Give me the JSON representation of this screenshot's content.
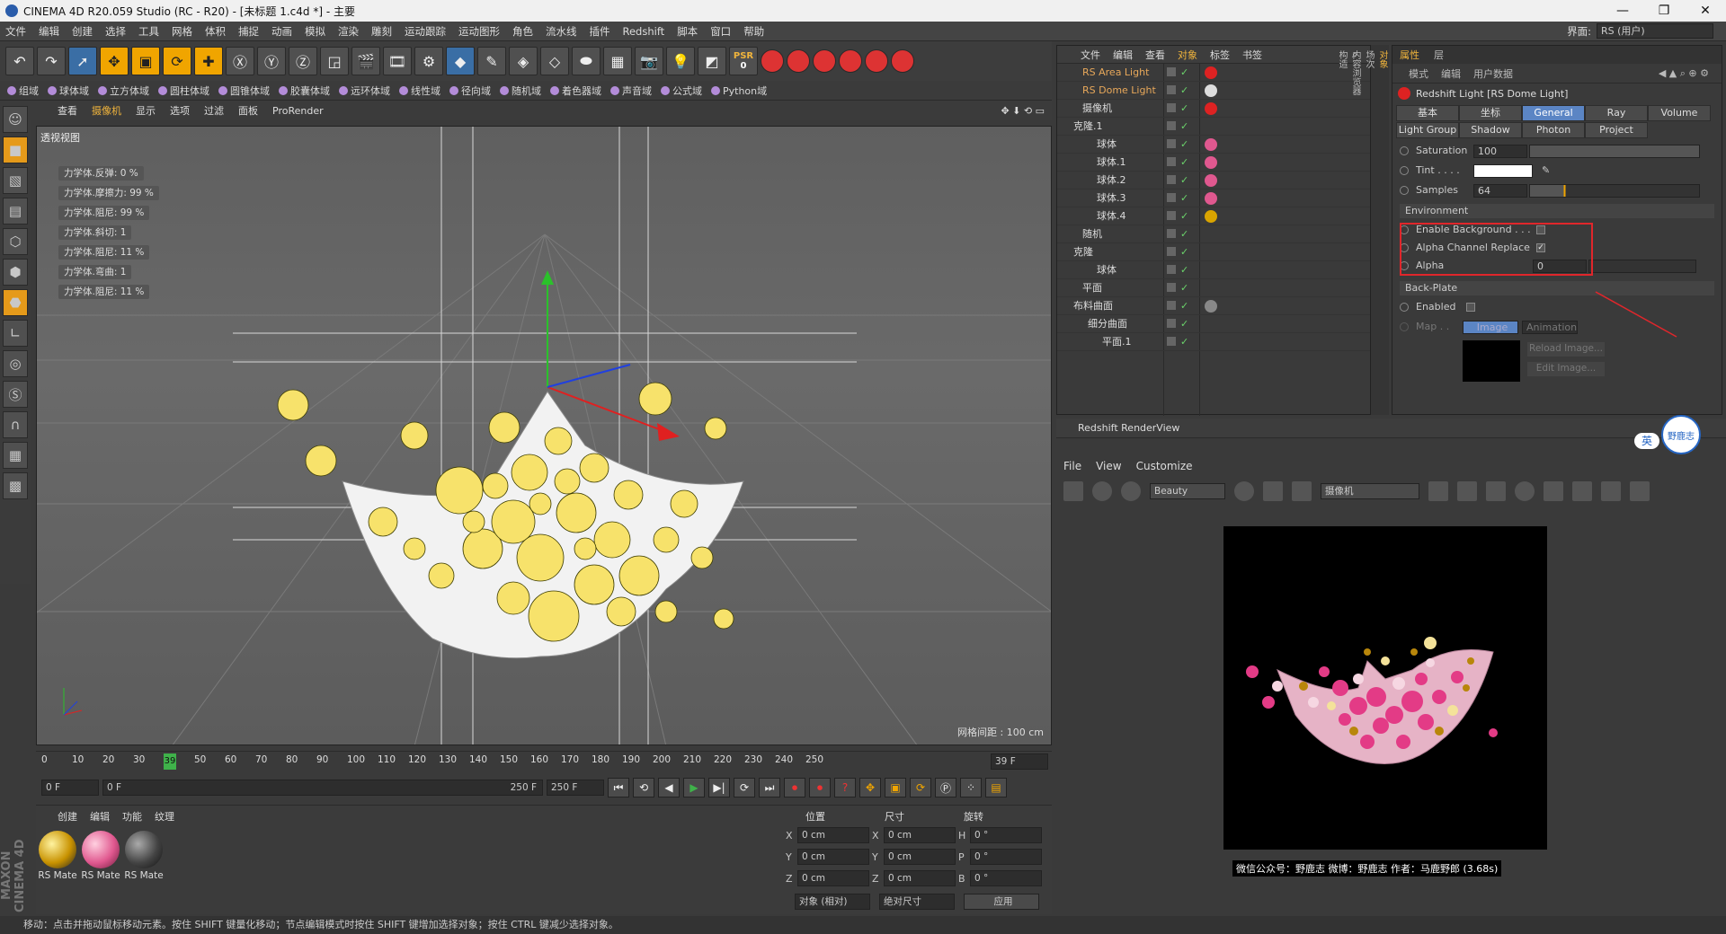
{
  "title": "CINEMA 4D R20.059 Studio (RC - R20) - [未标题 1.c4d *] - 主要",
  "menu": [
    "文件",
    "编辑",
    "创建",
    "选择",
    "工具",
    "网格",
    "体积",
    "捕捉",
    "动画",
    "模拟",
    "渲染",
    "雕刻",
    "运动跟踪",
    "运动图形",
    "角色",
    "流水线",
    "插件",
    "Redshift",
    "脚本",
    "窗口",
    "帮助"
  ],
  "interface_label": "界面:",
  "interface_value": "RS (用户)",
  "psr_label": "PSR",
  "psr_value": "0",
  "fields": [
    "组域",
    "球体域",
    "立方体域",
    "圆柱体域",
    "圆锥体域",
    "胶囊体域",
    "远环体域",
    "线性域",
    "径向域",
    "随机域",
    "着色器域",
    "声音域",
    "公式域",
    "Python域"
  ],
  "viewport_menu": [
    "查看",
    "摄像机",
    "显示",
    "选项",
    "过滤",
    "面板",
    "ProRender"
  ],
  "viewport_label": "透视视图",
  "grid_info": "网格间距 : 100 cm",
  "dynamics": [
    "力学体.反弹: 0 %",
    "力学体.摩擦力: 99 %",
    "力学体.阻尼: 99 %",
    "力学体.斜切: 1",
    "力学体.阻尼: 11 %",
    "力学体.弯曲: 1",
    "力学体.阻尼: 11 %"
  ],
  "timeline": {
    "ticks": [
      "0",
      "10",
      "20",
      "30",
      "39",
      "50",
      "60",
      "70",
      "80",
      "90",
      "100",
      "110",
      "120",
      "130",
      "140",
      "150",
      "160",
      "170",
      "180",
      "190",
      "200",
      "210",
      "220",
      "230",
      "240",
      "250"
    ],
    "current": "39",
    "frame_field": "39 F",
    "start": "0 F",
    "start2": "0 F",
    "end": "250 F",
    "end2": "250 F"
  },
  "material_menu": [
    "创建",
    "编辑",
    "功能",
    "纹理"
  ],
  "materials": [
    {
      "label": "RS Mate",
      "color": "#d9a400"
    },
    {
      "label": "RS Mate",
      "color": "#e0588f"
    },
    {
      "label": "RS Mate",
      "color": "#444444"
    }
  ],
  "coord": {
    "headers": [
      "位置",
      "尺寸",
      "旋转"
    ],
    "rows": [
      [
        "X",
        "0 cm",
        "X",
        "0 cm",
        "H",
        "0 °"
      ],
      [
        "Y",
        "0 cm",
        "Y",
        "0 cm",
        "P",
        "0 °"
      ],
      [
        "Z",
        "0 cm",
        "Z",
        "0 cm",
        "B",
        "0 °"
      ]
    ],
    "mode1": "对象 (相对)",
    "mode2": "绝对尺寸",
    "apply": "应用"
  },
  "status": "移动：点击并拖动鼠标移动元素。按住 SHIFT 键量化移动；节点编辑模式时按住 SHIFT 键增加选择对象；按住 CTRL 键减少选择对象。",
  "maxon": "MAXON CINEMA 4D",
  "objmgr": {
    "menu": [
      "文件",
      "编辑",
      "查看",
      "对象",
      "标签",
      "书签"
    ],
    "rows": [
      {
        "name": "RS Area Light",
        "indent": 28,
        "red": true,
        "tag": "#d22"
      },
      {
        "name": "RS Dome Light",
        "indent": 28,
        "red": true,
        "tag": "#ddd"
      },
      {
        "name": "摄像机",
        "indent": 28,
        "red": false,
        "tag": "#d22"
      },
      {
        "name": "克隆.1",
        "indent": 18,
        "red": false,
        "tag": ""
      },
      {
        "name": "球体",
        "indent": 44,
        "red": false,
        "tag": "#e0588f"
      },
      {
        "name": "球体.1",
        "indent": 44,
        "red": false,
        "tag": "#e0588f"
      },
      {
        "name": "球体.2",
        "indent": 44,
        "red": false,
        "tag": "#e0588f"
      },
      {
        "name": "球体.3",
        "indent": 44,
        "red": false,
        "tag": "#e0588f"
      },
      {
        "name": "球体.4",
        "indent": 44,
        "red": false,
        "tag": "#d9a400"
      },
      {
        "name": "随机",
        "indent": 28,
        "red": false,
        "tag": ""
      },
      {
        "name": "克隆",
        "indent": 18,
        "red": false,
        "tag": ""
      },
      {
        "name": "球体",
        "indent": 44,
        "red": false,
        "tag": ""
      },
      {
        "name": "平面",
        "indent": 28,
        "red": false,
        "tag": ""
      },
      {
        "name": "布料曲面",
        "indent": 18,
        "red": false,
        "tag": "#888"
      },
      {
        "name": "细分曲面",
        "indent": 34,
        "red": false,
        "tag": ""
      },
      {
        "name": "平面.1",
        "indent": 50,
        "red": false,
        "tag": ""
      }
    ]
  },
  "sidetabs": [
    "对象",
    "场次",
    "内容浏览器",
    "构造"
  ],
  "attr": {
    "tabs": [
      "属性",
      "层"
    ],
    "menu": [
      "模式",
      "编辑",
      "用户数据"
    ],
    "title": "Redshift Light [RS Dome Light]",
    "row1": [
      "基本",
      "坐标",
      "General",
      "Ray",
      "Volume"
    ],
    "row2": [
      "Light Group",
      "Shadow",
      "Photon",
      "Project"
    ],
    "saturation_label": "Saturation",
    "saturation": "100",
    "tint_label": "Tint . . . .",
    "samples_label": "Samples",
    "samples": "64",
    "env_label": "Environment",
    "enable_bg": "Enable Background . . .",
    "alpha_replace": "Alpha Channel Replace",
    "alpha_label": "Alpha",
    "alpha": "0",
    "backplate": "Back-Plate",
    "enabled": "Enabled",
    "map": "Map . .",
    "image": "Image",
    "animation": "Animation",
    "reload": "Reload Image...",
    "edit": "Edit Image..."
  },
  "renderview": {
    "title": "Redshift RenderView",
    "menu": [
      "File",
      "View",
      "Customize"
    ],
    "aov": "Beauty",
    "camera": "摄像机",
    "caption": "微信公众号：野鹿志  微博：野鹿志  作者：马鹿野郎 (3.68s)"
  },
  "badge": {
    "lang": "英",
    "logo": "野鹿志"
  }
}
